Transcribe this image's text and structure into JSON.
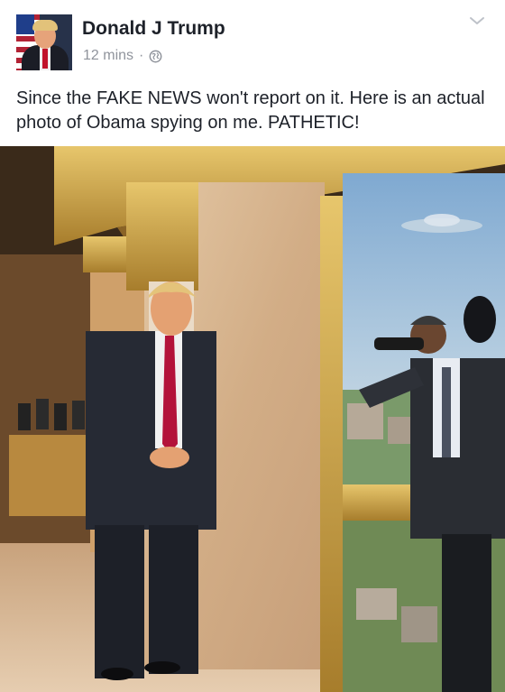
{
  "post": {
    "author_name": "Donald J Trump",
    "timestamp": "12 mins",
    "separator": "·",
    "privacy_icon": "globe-icon",
    "menu_icon": "chevron-down-icon",
    "text": "Since the FAKE NEWS won't report on it. Here is an actual photo of Obama spying on me. PATHETIC!"
  },
  "photo": {
    "subject": "photo-attachment"
  },
  "colors": {
    "name": "#1d2129",
    "meta": "#90949c",
    "gold": "#c9a14a",
    "marble": "#d9b994",
    "sky": "#9fc0dc"
  }
}
